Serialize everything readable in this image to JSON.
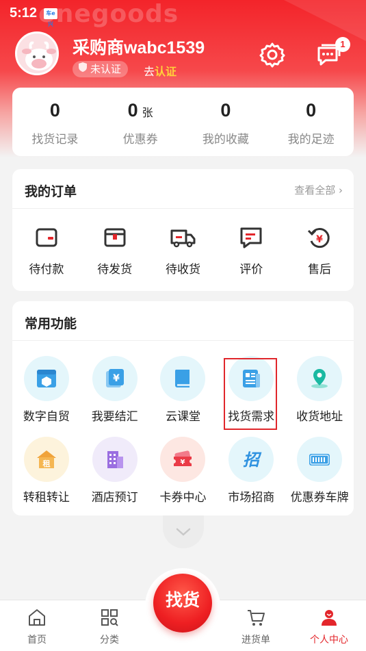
{
  "status_bar": {
    "time": "5:12",
    "app_icon_text": "车e兴"
  },
  "header": {
    "watermark": "onegoods",
    "username": "采购商wabc1539",
    "cert_status": "未认证",
    "go_cert_prefix": "去",
    "go_cert_action": "认证",
    "message_count": "1",
    "accent_color": "#f1262b"
  },
  "stats": [
    {
      "value": "0",
      "unit": "",
      "label": "找货记录"
    },
    {
      "value": "0",
      "unit": "张",
      "label": "优惠券"
    },
    {
      "value": "0",
      "unit": "",
      "label": "我的收藏"
    },
    {
      "value": "0",
      "unit": "",
      "label": "我的足迹"
    }
  ],
  "orders": {
    "title": "我的订单",
    "view_all": "查看全部 ›",
    "items": [
      {
        "icon": "wallet-icon",
        "label": "待付款"
      },
      {
        "icon": "box-icon",
        "label": "待发货"
      },
      {
        "icon": "truck-icon",
        "label": "待收货"
      },
      {
        "icon": "comment-icon",
        "label": "评价"
      },
      {
        "icon": "refund-icon",
        "label": "售后"
      }
    ]
  },
  "functions": {
    "title": "常用功能",
    "items": [
      {
        "icon": "digital-trade-icon",
        "label": "数字自贸",
        "bg": "#e4f6fb"
      },
      {
        "icon": "exchange-settlement-icon",
        "label": "我要结汇",
        "bg": "#e4f6fb"
      },
      {
        "icon": "cloud-class-icon",
        "label": "云课堂",
        "bg": "#e4f6fb"
      },
      {
        "icon": "find-demand-icon",
        "label": "找货需求",
        "bg": "#e4f6fb"
      },
      {
        "icon": "location-icon",
        "label": "收货地址",
        "bg": "#e4f6fb"
      },
      {
        "icon": "rent-icon",
        "label": "转租转让",
        "bg": "#fdf3dc"
      },
      {
        "icon": "hotel-icon",
        "label": "酒店预订",
        "bg": "#f0ebfa"
      },
      {
        "icon": "ticket-icon",
        "label": "卡券中心",
        "bg": "#fde7e2"
      },
      {
        "icon": "merchant-icon",
        "label": "市场招商",
        "bg": "#e4f6fb"
      },
      {
        "icon": "license-plate-icon",
        "label": "优惠券车牌",
        "bg": "#e4f6fb"
      }
    ]
  },
  "tabbar": {
    "center_label": "找货",
    "tabs": [
      {
        "icon": "home-icon",
        "label": "首页",
        "active": false
      },
      {
        "icon": "category-icon",
        "label": "分类",
        "active": false
      },
      {
        "icon": "cart-icon",
        "label": "进货单",
        "active": false
      },
      {
        "icon": "user-icon",
        "label": "个人中心",
        "active": true
      }
    ]
  }
}
